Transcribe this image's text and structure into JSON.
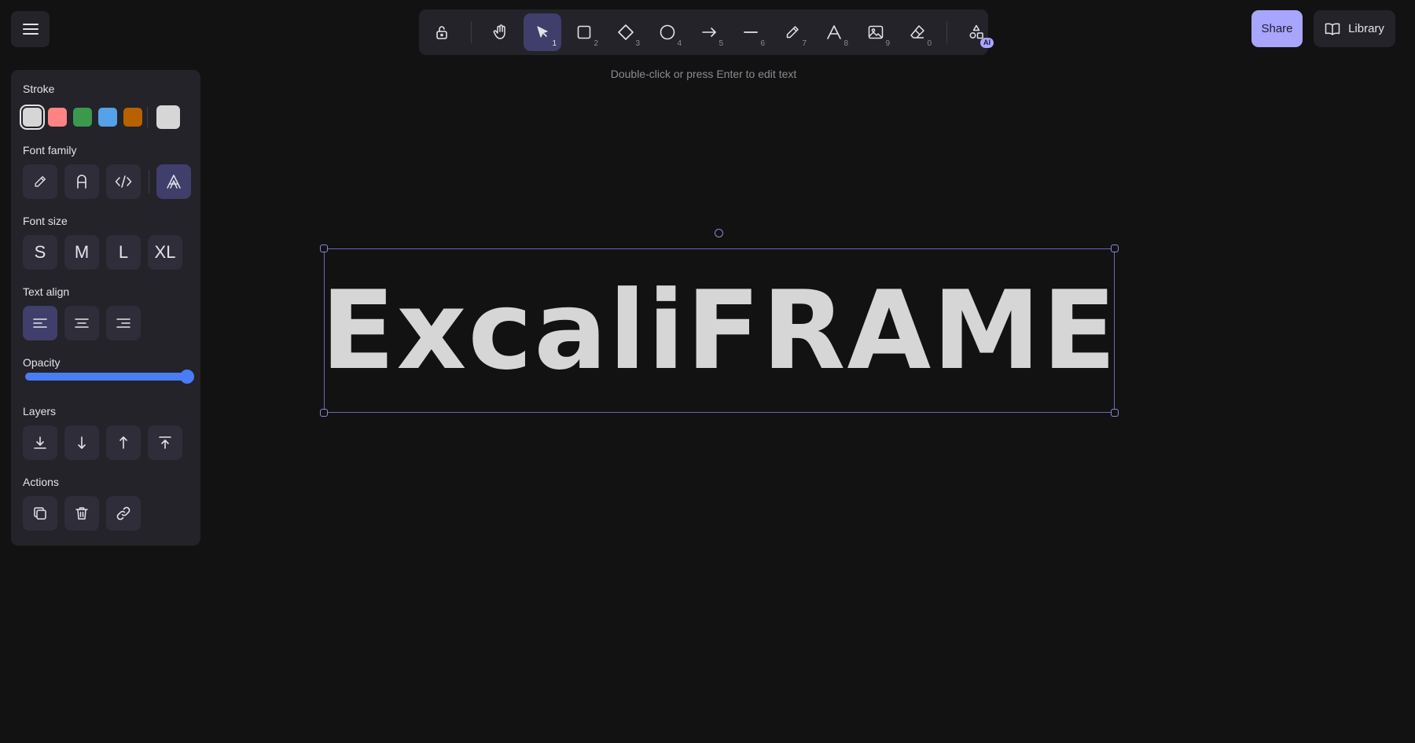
{
  "toolbar": {
    "tools": [
      {
        "name": "lock",
        "key": ""
      },
      {
        "name": "hand",
        "key": ""
      },
      {
        "name": "selection",
        "key": "1"
      },
      {
        "name": "rectangle",
        "key": "2"
      },
      {
        "name": "diamond",
        "key": "3"
      },
      {
        "name": "ellipse",
        "key": "4"
      },
      {
        "name": "arrow",
        "key": "5"
      },
      {
        "name": "line",
        "key": "6"
      },
      {
        "name": "draw",
        "key": "7"
      },
      {
        "name": "text",
        "key": "8"
      },
      {
        "name": "image",
        "key": "9"
      },
      {
        "name": "eraser",
        "key": "0"
      },
      {
        "name": "more-tools",
        "key": ""
      }
    ],
    "active_tool": "selection",
    "ai_badge": "AI"
  },
  "hint": "Double-click or press Enter to edit text",
  "top_right": {
    "share_label": "Share",
    "library_label": "Library"
  },
  "panel": {
    "stroke": {
      "title": "Stroke",
      "colors": [
        "#d6d6d6",
        "#ff8383",
        "#3a994c",
        "#56a2e8",
        "#b76100"
      ],
      "selected": "#d6d6d6",
      "current": "#d6d6d6"
    },
    "font_family": {
      "title": "Font family",
      "options": [
        "hand-drawn",
        "normal",
        "code",
        "excalifont"
      ],
      "selected": "excalifont"
    },
    "font_size": {
      "title": "Font size",
      "options": [
        "S",
        "M",
        "L",
        "XL"
      ]
    },
    "text_align": {
      "title": "Text align",
      "options": [
        "left",
        "center",
        "right"
      ],
      "selected": "left"
    },
    "opacity": {
      "title": "Opacity",
      "value": 100
    },
    "layers": {
      "title": "Layers",
      "options": [
        "send-to-back",
        "send-backward",
        "bring-forward",
        "bring-to-front"
      ]
    },
    "actions": {
      "title": "Actions",
      "options": [
        "duplicate",
        "delete",
        "link"
      ]
    }
  },
  "canvas": {
    "text": "ExcaliFRAME",
    "text_color": "#d6d6d6"
  },
  "colors": {
    "background": "#121212",
    "panel": "#232329",
    "accent": "#a8a5ff",
    "active": "#403e6a",
    "slider": "#4a7cf5"
  }
}
